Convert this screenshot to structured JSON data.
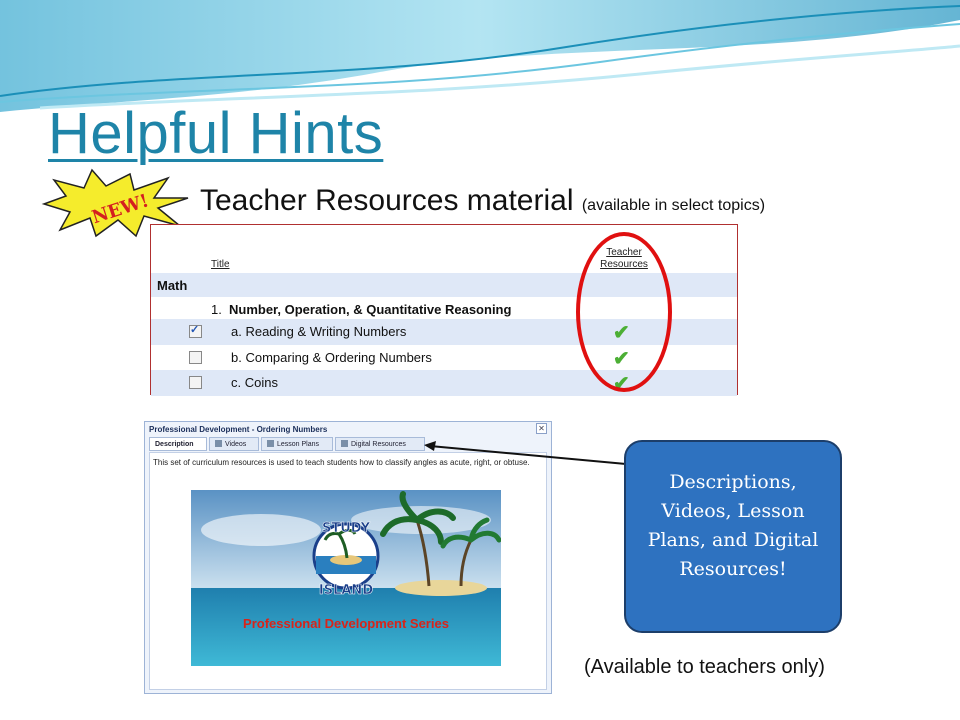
{
  "slide": {
    "title": "Helpful Hints",
    "badge": "NEW!",
    "subtitle_main": "Teacher Resources material",
    "subtitle_note": "(available in select topics)"
  },
  "topics_table": {
    "col_title": "Title",
    "col_teacher_resources": "Teacher Resources",
    "subject": "Math",
    "topic_number": "1.",
    "topic_name": "Number, Operation, & Quantitative Reasoning",
    "lessons": [
      {
        "label": "a. Reading & Writing Numbers",
        "checked": true,
        "has_resources": true
      },
      {
        "label": "b. Comparing & Ordering Numbers",
        "checked": false,
        "has_resources": true
      },
      {
        "label": "c. Coins",
        "checked": false,
        "has_resources": true
      }
    ]
  },
  "pd_window": {
    "title": "Professional Development - Ordering Numbers",
    "close": "✕",
    "tabs": [
      {
        "label": "Description",
        "active": true,
        "icon": "none"
      },
      {
        "label": "Videos",
        "active": false,
        "icon": "film-icon"
      },
      {
        "label": "Lesson Plans",
        "active": false,
        "icon": "document-icon"
      },
      {
        "label": "Digital Resources",
        "active": false,
        "icon": "monitor-icon"
      }
    ],
    "description": "This set of curriculum resources is used to teach students how to classify angles as acute, right, or obtuse.",
    "logo_top": "STUDY",
    "logo_bottom": "ISLAND",
    "banner_caption": "Professional Development Series"
  },
  "callout": {
    "text": "Descriptions, Videos, Lesson Plans, and Digital Resources!"
  },
  "footnote": "(Available to teachers only)",
  "colors": {
    "title": "#1e84a8",
    "callout_fill": "#2e72c0",
    "highlight_oval": "#e01010",
    "row_alt": "#dfe8f7",
    "check_green": "#4caf35"
  }
}
